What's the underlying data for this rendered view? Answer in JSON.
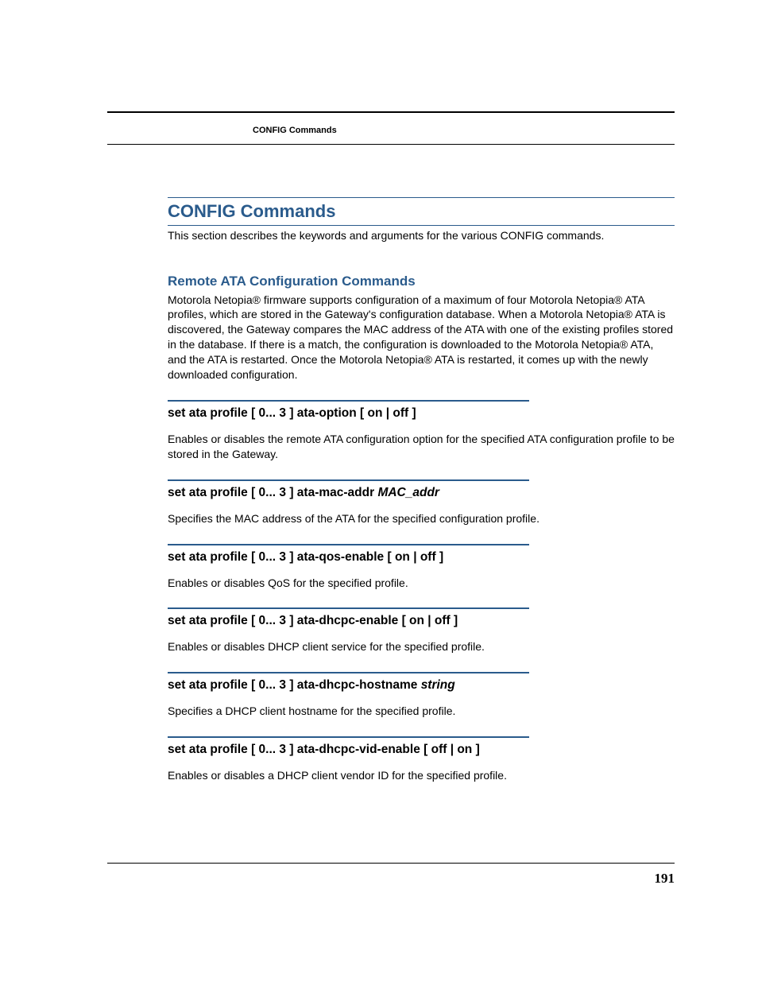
{
  "runningHeader": "CONFIG Commands",
  "sectionTitle": "CONFIG Commands",
  "intro": "This section describes the keywords and arguments for the various CONFIG commands.",
  "subTitle": "Remote ATA Configuration Commands",
  "subPara": "Motorola Netopia® firmware supports configuration of a maximum of four Motorola Netopia® ATA profiles, which are stored in the Gateway's configuration database. When a Motorola Netopia® ATA is discovered, the Gateway compares the MAC address of the ATA with one of the existing profiles stored in the database. If there is a match, the configuration is downloaded to the Motorola Netopia® ATA, and the ATA is restarted. Once the Motorola Netopia® ATA is restarted, it comes up with the newly downloaded configuration.",
  "commands": [
    {
      "heading": "set ata profile [  0... 3 ] ata-option [ on | off ]",
      "italicTail": "",
      "desc": "Enables or disables the remote ATA configuration option for the specified ATA configuration profile to be stored in the Gateway."
    },
    {
      "heading": "set ata profile [  0... 3 ] ata-mac-addr ",
      "italicTail": "MAC_addr",
      "desc": "Specifies the MAC address of the ATA for the specified configuration profile."
    },
    {
      "heading": "set ata profile [  0... 3 ] ata-qos-enable [ on | off ]",
      "italicTail": "",
      "desc": "Enables or disables QoS for the specified profile."
    },
    {
      "heading": "set ata profile [  0... 3 ] ata-dhcpc-enable [ on | off ]",
      "italicTail": "",
      "desc": "Enables or disables DHCP client service for the specified profile."
    },
    {
      "heading": "set ata profile [  0... 3 ] ata-dhcpc-hostname ",
      "italicTail": "string",
      "desc": "Specifies a DHCP client hostname for the specified profile."
    },
    {
      "heading": "set ata profile [  0... 3 ] ata-dhcpc-vid-enable [ off | on ]",
      "italicTail": "",
      "desc": "Enables or disables a DHCP client vendor ID for the specified profile."
    }
  ],
  "pageNumber": "191"
}
